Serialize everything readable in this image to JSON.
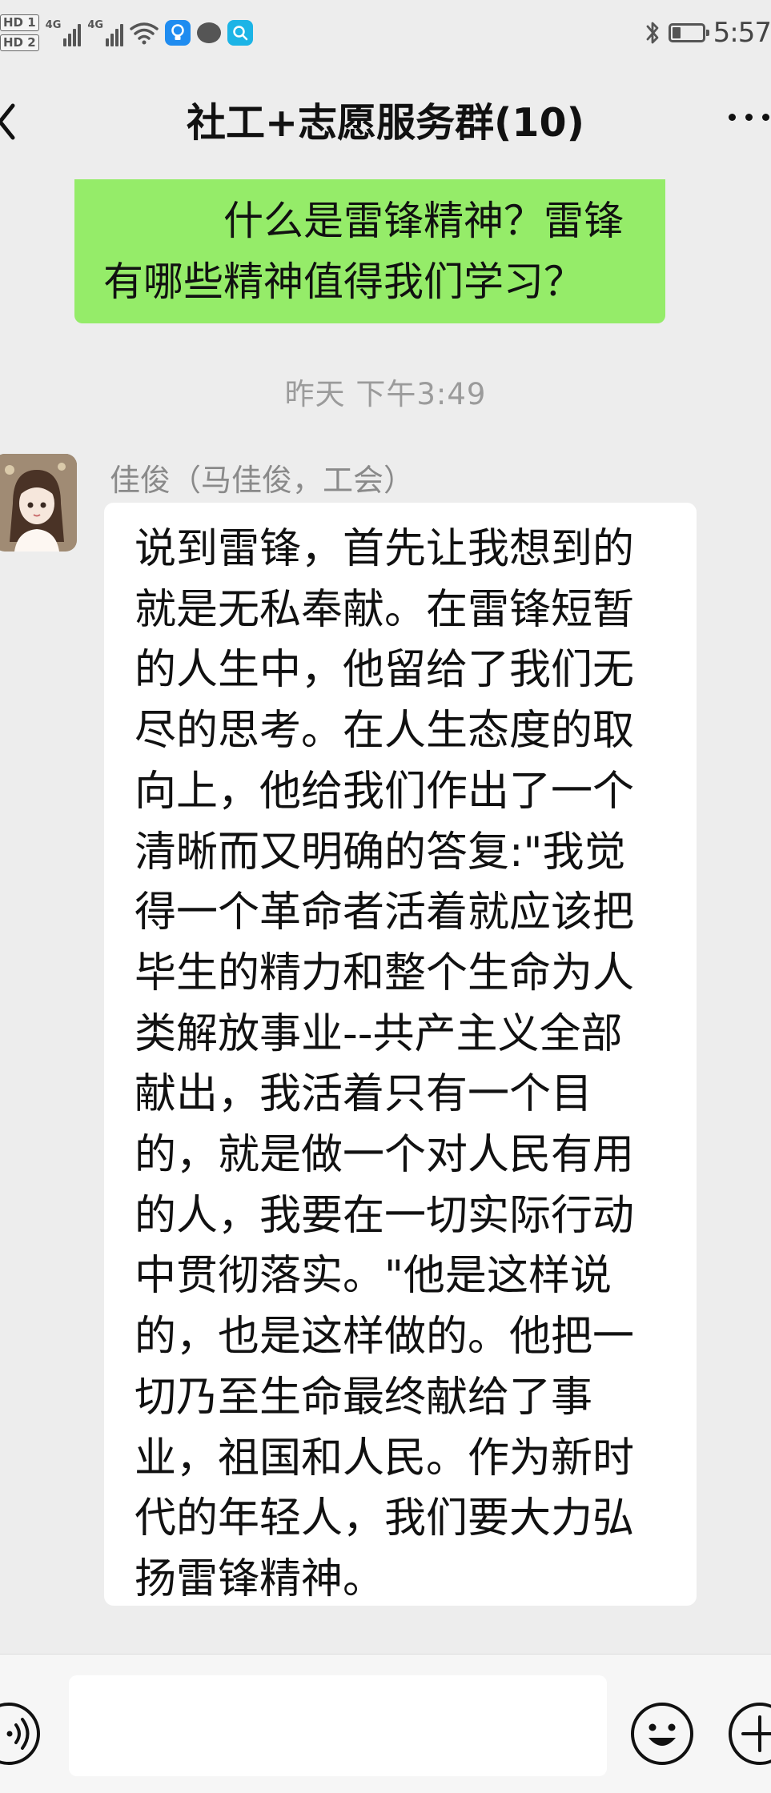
{
  "status_bar": {
    "sim1": "HD 1",
    "sim2": "HD 2",
    "network1": "4G",
    "network2": "4G",
    "time": "5:57"
  },
  "header": {
    "title": "社工+志愿服务群(10)",
    "back_icon": "chevron-left-icon",
    "more_icon": "more-dots-icon"
  },
  "messages": [
    {
      "type": "outgoing",
      "text": "什么是雷锋精神？雷锋有哪些精神值得我们学习？",
      "lines": [
        "什么是雷锋精神？雷锋",
        "有哪些精神值得我们学习？"
      ],
      "bubble_color": "#95ec69"
    },
    {
      "type": "timestamp",
      "text": "昨天 下午3:49"
    },
    {
      "type": "incoming",
      "sender": "佳俊（马佳俊，工会）",
      "text": "说到雷锋，首先让我想到的就是无私奉献。在雷锋短暂的人生中，他留给了我们无尽的思考。在人生态度的取向上，他给我们作出了一个清晰而又明确的答复:\"我觉得一个革命者活着就应该把毕生的精力和整个生命为人类解放事业--共产主义全部献出，我活着只有一个目的，就是做一个对人民有用的人，我要在一切实际行动中贯彻落实。\"他是这样说的，也是这样做的。他把一切乃至生命最终献给了事业，祖国和人民。作为新时代的年轻人，我们要大力弘扬雷锋精神。",
      "lines": [
        "说到雷锋，首先让我想到的",
        "就是无私奉献。在雷锋短暂",
        "的人生中，他留给了我们无",
        "尽的思考。在人生态度的取",
        "向上，他给我们作出了一个",
        "清晰而又明确的答复:\"我觉",
        "得一个革命者活着就应该把",
        "毕生的精力和整个生命为人",
        "类解放事业--共产主义全部",
        "献出，我活着只有一个目",
        "的，就是做一个对人民有用",
        "的人，我要在一切实际行动",
        "中贯彻落实。\"他是这样说",
        "的，也是这样做的。他把一",
        "切乃至生命最终献给了事",
        "业，祖国和人民。作为新时",
        "代的年轻人，我们要大力弘",
        "扬雷锋精神。"
      ],
      "bubble_color": "#ffffff"
    }
  ],
  "input_bar": {
    "value": "",
    "placeholder": "",
    "voice_icon": "voice-icon",
    "emoji_icon": "emoji-icon",
    "plus_icon": "plus-icon"
  },
  "colors": {
    "background": "#ededed",
    "outgoing_bubble": "#95ec69",
    "incoming_bubble": "#ffffff",
    "timestamp_text": "#9b9b9b",
    "sender_text": "#8a8a8a"
  }
}
